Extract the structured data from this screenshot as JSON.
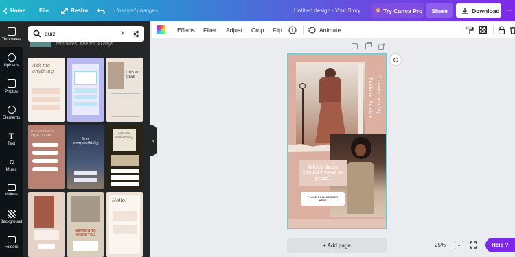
{
  "topbar": {
    "home": "Home",
    "file": "File",
    "resize": "Resize",
    "status": "Unsaved changes",
    "title": "Untitled design - Your Story",
    "try_pro": "Try Canva Pro",
    "share": "Share",
    "download": "Download"
  },
  "rail": [
    "Templates",
    "Uploads",
    "Photos",
    "Elements",
    "Text",
    "Music",
    "Videos",
    "Background",
    "Folders"
  ],
  "search": {
    "value": "quiz",
    "subtext": "templates, free for 30 days."
  },
  "templates": [
    {
      "text": "Ask me anything"
    },
    {
      "text": ""
    },
    {
      "text": "this or that"
    },
    {
      "text": "this or that // style points"
    },
    {
      "text": "love compatibility"
    },
    {
      "text": "tell me something"
    },
    {
      "text": ""
    },
    {
      "text": "GETTING TO KNOW YOU"
    },
    {
      "text": "Hello!"
    }
  ],
  "toolbar": {
    "effects": "Effects",
    "filter": "Filter",
    "adjust": "Adjust",
    "crop": "Crop",
    "flip": "Flip",
    "animate": "Animate"
  },
  "design": {
    "side_text_1": "Crowdsourcing",
    "side_text_2": "Fashion Advice",
    "question": "Which dress should I wear to prom?",
    "sticker": "PLACE POLL STICKER HERE"
  },
  "add_page": "+ Add page",
  "zoom": "25%",
  "page_count": "1",
  "help": "Help ?",
  "colors": {
    "rail_bg": "#0e1318",
    "panel_bg": "#252627",
    "page_bg": "#dcb0a0",
    "download_bg": "#ffffff",
    "try_pro_bg": "#7f4de0"
  }
}
